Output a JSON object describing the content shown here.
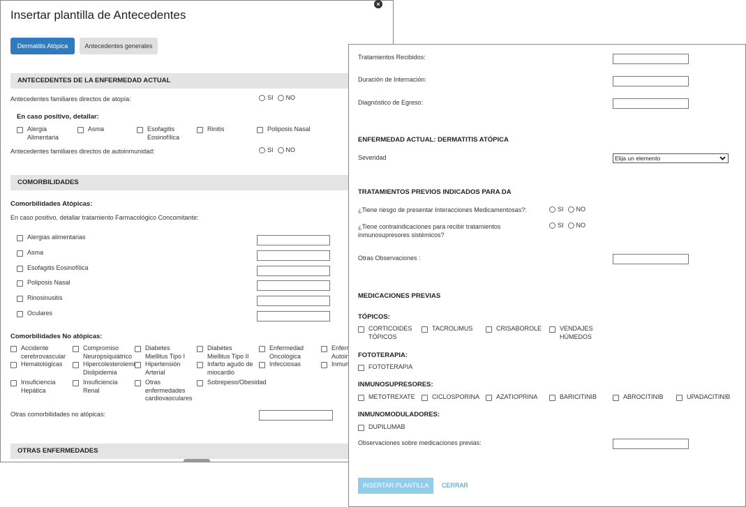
{
  "left": {
    "title": "Insertar plantilla de Antecedentes",
    "tabs": [
      "Dermatitis Atópica",
      "Antecedentes generales"
    ],
    "sec1": "ANTECEDENTES DE LA ENFERMEDAD ACTUAL",
    "fam_atopia": "Antecedentes familiares directos de atopía:",
    "yes": "SI",
    "no": "NO",
    "detallar": "En caso positivo, detallar:",
    "atopia_items": [
      "Alergia\nAlimentaria",
      "Asma",
      "Esofagitis\nEosinofílica",
      "Rinitis",
      "Poliposis Nasal"
    ],
    "fam_autoinm": "Antecedentes familiares directos de autoinmunidad:",
    "sec2": "COMORBILIDADES",
    "comorb_atop_title": "Comorbilidades Atópicas:",
    "comorb_atop_desc": "En caso positivo, detallar tratamiento Farmacológico Concomitante:",
    "comorb_atop_items": [
      "Alergias alimentarias",
      "Asma",
      "Esofagitis Eosinofílica",
      "Poliposis Nasal",
      "Rinosinusitis",
      "Oculares"
    ],
    "comorb_no_title": "Comorbilidades No atópicas:",
    "comorb_no_items": [
      "Accidente\ncerebrovascular",
      "Compromiso\nNeuropsiquiátrico",
      "Diabetes\nMiellitus Tipo I",
      "Diabetes\nMiellitus Tipo II",
      "Enfermedad\nOncológica",
      "Enferm\nAutoinm",
      "Hematológicas",
      "Hipercolesterolemia\nDislipidemia",
      "Hipertensión\nArterial",
      "Infarto agudo de\nmiocardio",
      "Infecciosas",
      "Inmune",
      "Insuficiencia\nHepática",
      "Insuficiencia\nRenal",
      "Otras\nenfermedades\ncardiovasculares",
      "Sobrepeso/Obesidad"
    ],
    "otras_comorb": "Otras comorbilidades no atópicas:",
    "sec3": "OTRAS ENFERMEDADES"
  },
  "right": {
    "trat_recibidos": "Tratamientos Recibidos:",
    "duracion": "Duración de Internación:",
    "diagnostico": "Diagnóstico de Egreso:",
    "sec_enf": "ENFERMEDAD ACTUAL: DERMATITIS ATÓPICA",
    "severidad": "Severidad",
    "severidad_value": "Elija un elemento",
    "sec_trat": "TRATAMIENTOS PREVIOS INDICADOS PARA DA",
    "riesgo": "¿Tiene riesgo de presentar Interacciones Medicamentosas?:",
    "contra": "¿Tiene contraindicaciones para recibir tratamientos\ninmunosupresores sistémicos?",
    "yes": "SI",
    "no": "NO",
    "otras_obs": "Otras Observaciones :",
    "sec_med": "MEDICACIONES PREVIAS",
    "topicos_title": "TÓPICOS:",
    "topicos": [
      "CORTICOIDES\nTÓPICOS",
      "TACROLIMUS",
      "CRISABOROLE",
      "VENDAJES\nHÚMEDOS"
    ],
    "foto_title": "FOTOTERAPIA:",
    "foto": [
      "FOTOTERAPIA"
    ],
    "inmunosup_title": "INMUNOSUPRESORES:",
    "inmunosup": [
      "METOTREXATE",
      "CICLOSPORINA",
      "AZATIOPRINA",
      "BARICITINIB",
      "ABROCITINIB",
      "UPADACITINIB"
    ],
    "inmunomod_title": "INMUNOMODULADORES:",
    "inmunomod": [
      "DUPILUMAB"
    ],
    "obs_med": "Observaciones sobre medicaciones previas:",
    "insert_button": "INSERTAR PLANTILLA",
    "cancel_button": "CERRAR"
  },
  "colors": {
    "primary": "#2f7bbf",
    "primary_disabled": "#8fcdea",
    "tab_inactive": "#e0e0e0",
    "section_bg": "#e4e4e4",
    "link": "#3a8fd0"
  },
  "icons": {
    "close": "close-icon",
    "checkbox": "checkbox-icon",
    "radio": "radio-icon",
    "chevron": "chevron-down-icon"
  }
}
